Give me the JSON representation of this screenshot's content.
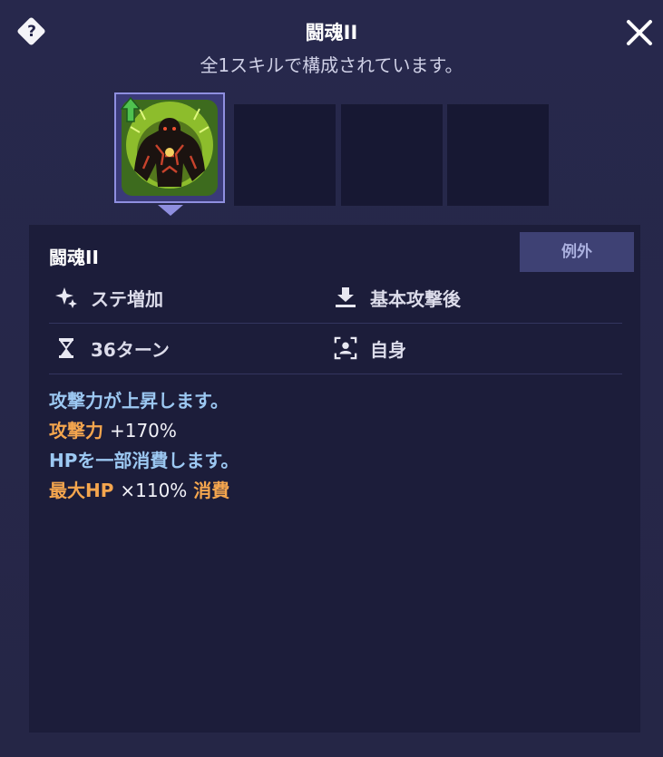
{
  "header": {
    "title": "闘魂II",
    "subtitle": "全1スキルで構成されています。",
    "help_glyph": "?"
  },
  "icons": {
    "help": "help-diamond-icon",
    "close": "close-icon",
    "effect": "sparkle-buff-icon",
    "timing": "download-arrow-icon",
    "duration": "hourglass-icon",
    "target": "self-target-icon",
    "upgrade": "green-up-arrow-icon"
  },
  "colors": {
    "accent_orange": "#f5a64e",
    "accent_blue": "#9cc8f2",
    "panel_bg": "#252646",
    "detail_bg": "#1c1d3a"
  },
  "skill": {
    "name": "闘魂II",
    "tag": "例外",
    "effect_type": "ステ増加",
    "timing": "基本攻撃後",
    "duration": "36ターン",
    "target": "自身",
    "description": {
      "line1": "攻撃力が上昇します。",
      "line2_label": "攻撃力",
      "line2_value": "+170%",
      "line3": "HPを一部消費します。",
      "line4_label": "最大HP",
      "line4_value": "×110%",
      "line4_suffix": "消費"
    }
  }
}
